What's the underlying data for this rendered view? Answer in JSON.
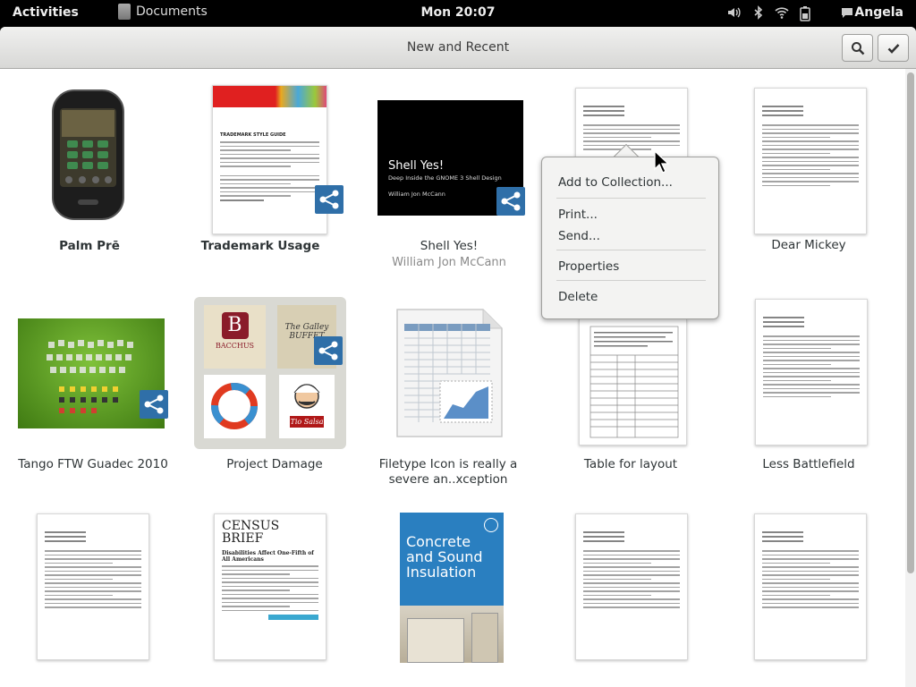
{
  "top_bar": {
    "activities": "Activities",
    "app_name": "Documents",
    "clock": "Mon 20:07",
    "status_icons": [
      "volume-icon",
      "bluetooth-icon",
      "wifi-icon",
      "battery-icon",
      "chat-icon"
    ],
    "user": "Angela"
  },
  "header": {
    "title": "New and Recent",
    "search_icon": "search-icon",
    "select_icon": "checkmark-icon"
  },
  "documents": [
    {
      "title": "Palm Prē",
      "bold": true
    },
    {
      "title": "Trademark Usage",
      "bold": true,
      "shared": true,
      "cover_title": "TRADEMARK STYLE GUIDE"
    },
    {
      "title": "Shell Yes!",
      "author": "William Jon McCann",
      "shared": true,
      "cover_title": "Shell Yes!",
      "cover_subtitle": "Deep Inside the GNOME 3 Shell Design",
      "cover_author": "William Jon McCann"
    },
    {
      "title": "",
      "context_menu_open": true
    },
    {
      "title": "Dear Mickey"
    },
    {
      "title": "Tango FTW Guadec 2010",
      "shared": true
    },
    {
      "title": "Project Damage",
      "shared": true,
      "selected": true,
      "tiles": [
        "BACCHUS",
        "The Galley BUFFET",
        "Tio Salsa"
      ]
    },
    {
      "title": "Filetype Icon is really a severe an..xception"
    },
    {
      "title": "Table for layout"
    },
    {
      "title": "Less Battlefield"
    },
    {
      "title": ""
    },
    {
      "title": "",
      "cover_title": "CENSUS BRIEF",
      "cover_subtitle": "Disabilities Affect One-Fifth of All Americans"
    },
    {
      "title": "",
      "cover_title": "Concrete and Sound Insulation"
    },
    {
      "title": ""
    },
    {
      "title": ""
    }
  ],
  "context_menu": {
    "items": [
      "Add to Collection...",
      "Print...",
      "Send...",
      "Properties",
      "Delete"
    ]
  },
  "colors": {
    "top_bar_bg": "#000000",
    "share_badge": "#2f6fa8",
    "selected_item_bg": "#d9d9d3"
  }
}
